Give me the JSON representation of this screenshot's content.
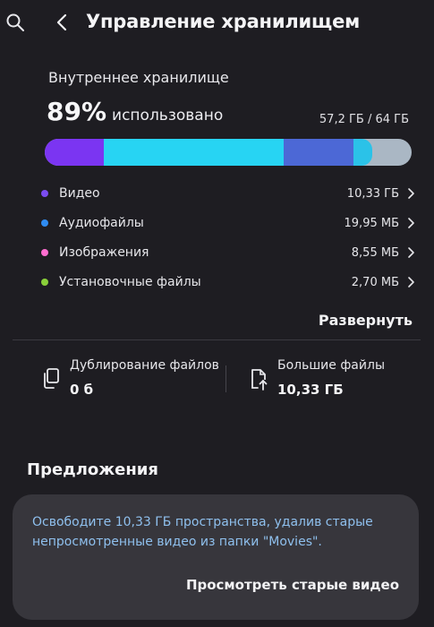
{
  "header": {
    "title": "Управление хранилищем",
    "search_icon": "search-icon",
    "back_icon": "chevron-left-icon"
  },
  "storage": {
    "label": "Внутреннее хранилище",
    "percent": "89%",
    "used_text": "использовано",
    "used_amount": "57,2 ГБ / 64 ГБ",
    "used_fraction": 0.89,
    "bar_segments": [
      {
        "name": "video",
        "color": "#7b35f2",
        "fraction": 0.16
      },
      {
        "name": "audio",
        "color": "#27d4f3",
        "fraction": 0.49
      },
      {
        "name": "other",
        "color": "#4c68d6",
        "fraction": 0.19
      },
      {
        "name": "system",
        "color": "#2bc2e8",
        "fraction": 0.05
      }
    ]
  },
  "categories": [
    {
      "label": "Видео",
      "size": "10,33 ГБ",
      "color": "#7b4cf0"
    },
    {
      "label": "Аудиофайлы",
      "size": "19,95 МБ",
      "color": "#2f8cf2"
    },
    {
      "label": "Изображения",
      "size": "8,55 МБ",
      "color": "#ff6ed0"
    },
    {
      "label": "Установочные файлы",
      "size": "2,70 МБ",
      "color": "#8ad03a"
    }
  ],
  "expand_label": "Развернуть",
  "tiles": {
    "duplicates": {
      "title": "Дублирование файлов",
      "value": "0 б",
      "icon": "copy-files-icon"
    },
    "large": {
      "title": "Большие файлы",
      "value": "10,33 ГБ",
      "icon": "large-file-icon"
    }
  },
  "suggestions": {
    "heading": "Предложения",
    "text": "Освободите 10,33 ГБ пространства, удалив старые непросмотренные видео из папки \"Movies\".",
    "action": "Просмотреть старые видео"
  }
}
